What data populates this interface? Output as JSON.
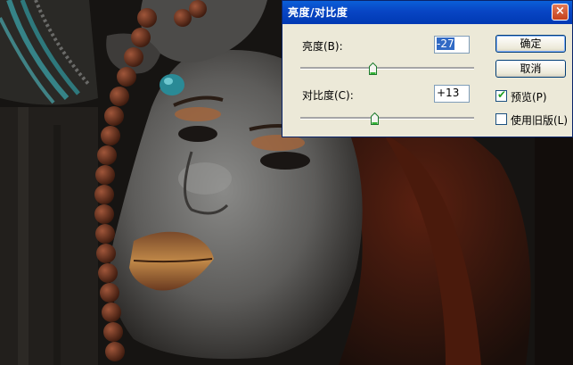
{
  "dialog": {
    "title": "亮度/对比度",
    "close_glyph": "×",
    "brightness": {
      "label": "亮度(B):",
      "value": "-27",
      "level": -27
    },
    "contrast": {
      "label": "对比度(C):",
      "value": "+13",
      "level": 13
    },
    "buttons": {
      "ok": "确定",
      "cancel": "取消"
    },
    "preview": {
      "label": "预览(P)",
      "checked": true
    },
    "legacy": {
      "label": "使用旧版(L)",
      "checked": false
    }
  },
  "colors": {
    "titlebar": "#0845c4",
    "dialog_bg": "#ece9d8",
    "selection": "#316ac5"
  }
}
